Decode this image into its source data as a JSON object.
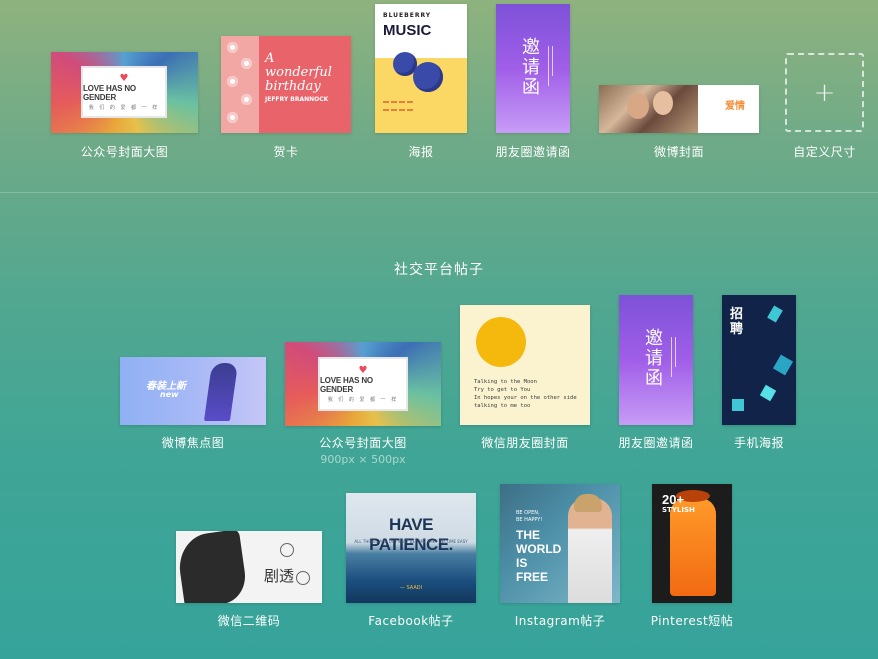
{
  "top_row": [
    {
      "label": "公众号封面大图"
    },
    {
      "label": "贺卡"
    },
    {
      "label": "海报"
    },
    {
      "label": "朋友圈邀请函"
    },
    {
      "label": "微博封面"
    },
    {
      "label": "自定义尺寸"
    }
  ],
  "section": {
    "title": "社交平台帖子"
  },
  "row2": [
    {
      "label": "微博焦点图"
    },
    {
      "label": "公众号封面大图",
      "size": "900px × 500px"
    },
    {
      "label": "微信朋友圈封面"
    },
    {
      "label": "朋友圈邀请函"
    },
    {
      "label": "手机海报"
    }
  ],
  "row3": [
    {
      "label": "微信二维码"
    },
    {
      "label": "Facebook帖子"
    },
    {
      "label": "Instagram帖子"
    },
    {
      "label": "Pinterest短帖"
    }
  ],
  "thumb_text": {
    "love_title": "LOVE HAS NO GENDER",
    "love_sub": "我 们 的 爱 都 一 样",
    "birthday_title": "A wonderful birthday",
    "birthday_name": "JEFFRY BRANNOCK",
    "poster_top": "BLUEBERRY",
    "poster_music": "MUSIC",
    "invite_chars": "邀请函",
    "weibo_love": "爱情",
    "custom_plus": "+",
    "focus_line1": "春装上新",
    "focus_line2": "new",
    "moments_lines": [
      "Talking to the Moon",
      "Try to get to You",
      "In hopes your on the other side",
      "talking to me too"
    ],
    "phone_zh1": "招",
    "phone_zh2": "聘",
    "qr_chars": "剧透",
    "fb_title": "HAVE PATIENCE.",
    "fb_sub": "ALL THINGS ARE DIFFICULT BEFORE THEY BECOME EASY",
    "fb_sig": "— SAADI",
    "ig_small": "BE OPEN,\nBE HAPPY!",
    "ig_words": [
      "THE",
      "WORLD",
      "IS",
      "FREE"
    ],
    "pin_num": "20+",
    "pin_word": "STYLISH"
  }
}
